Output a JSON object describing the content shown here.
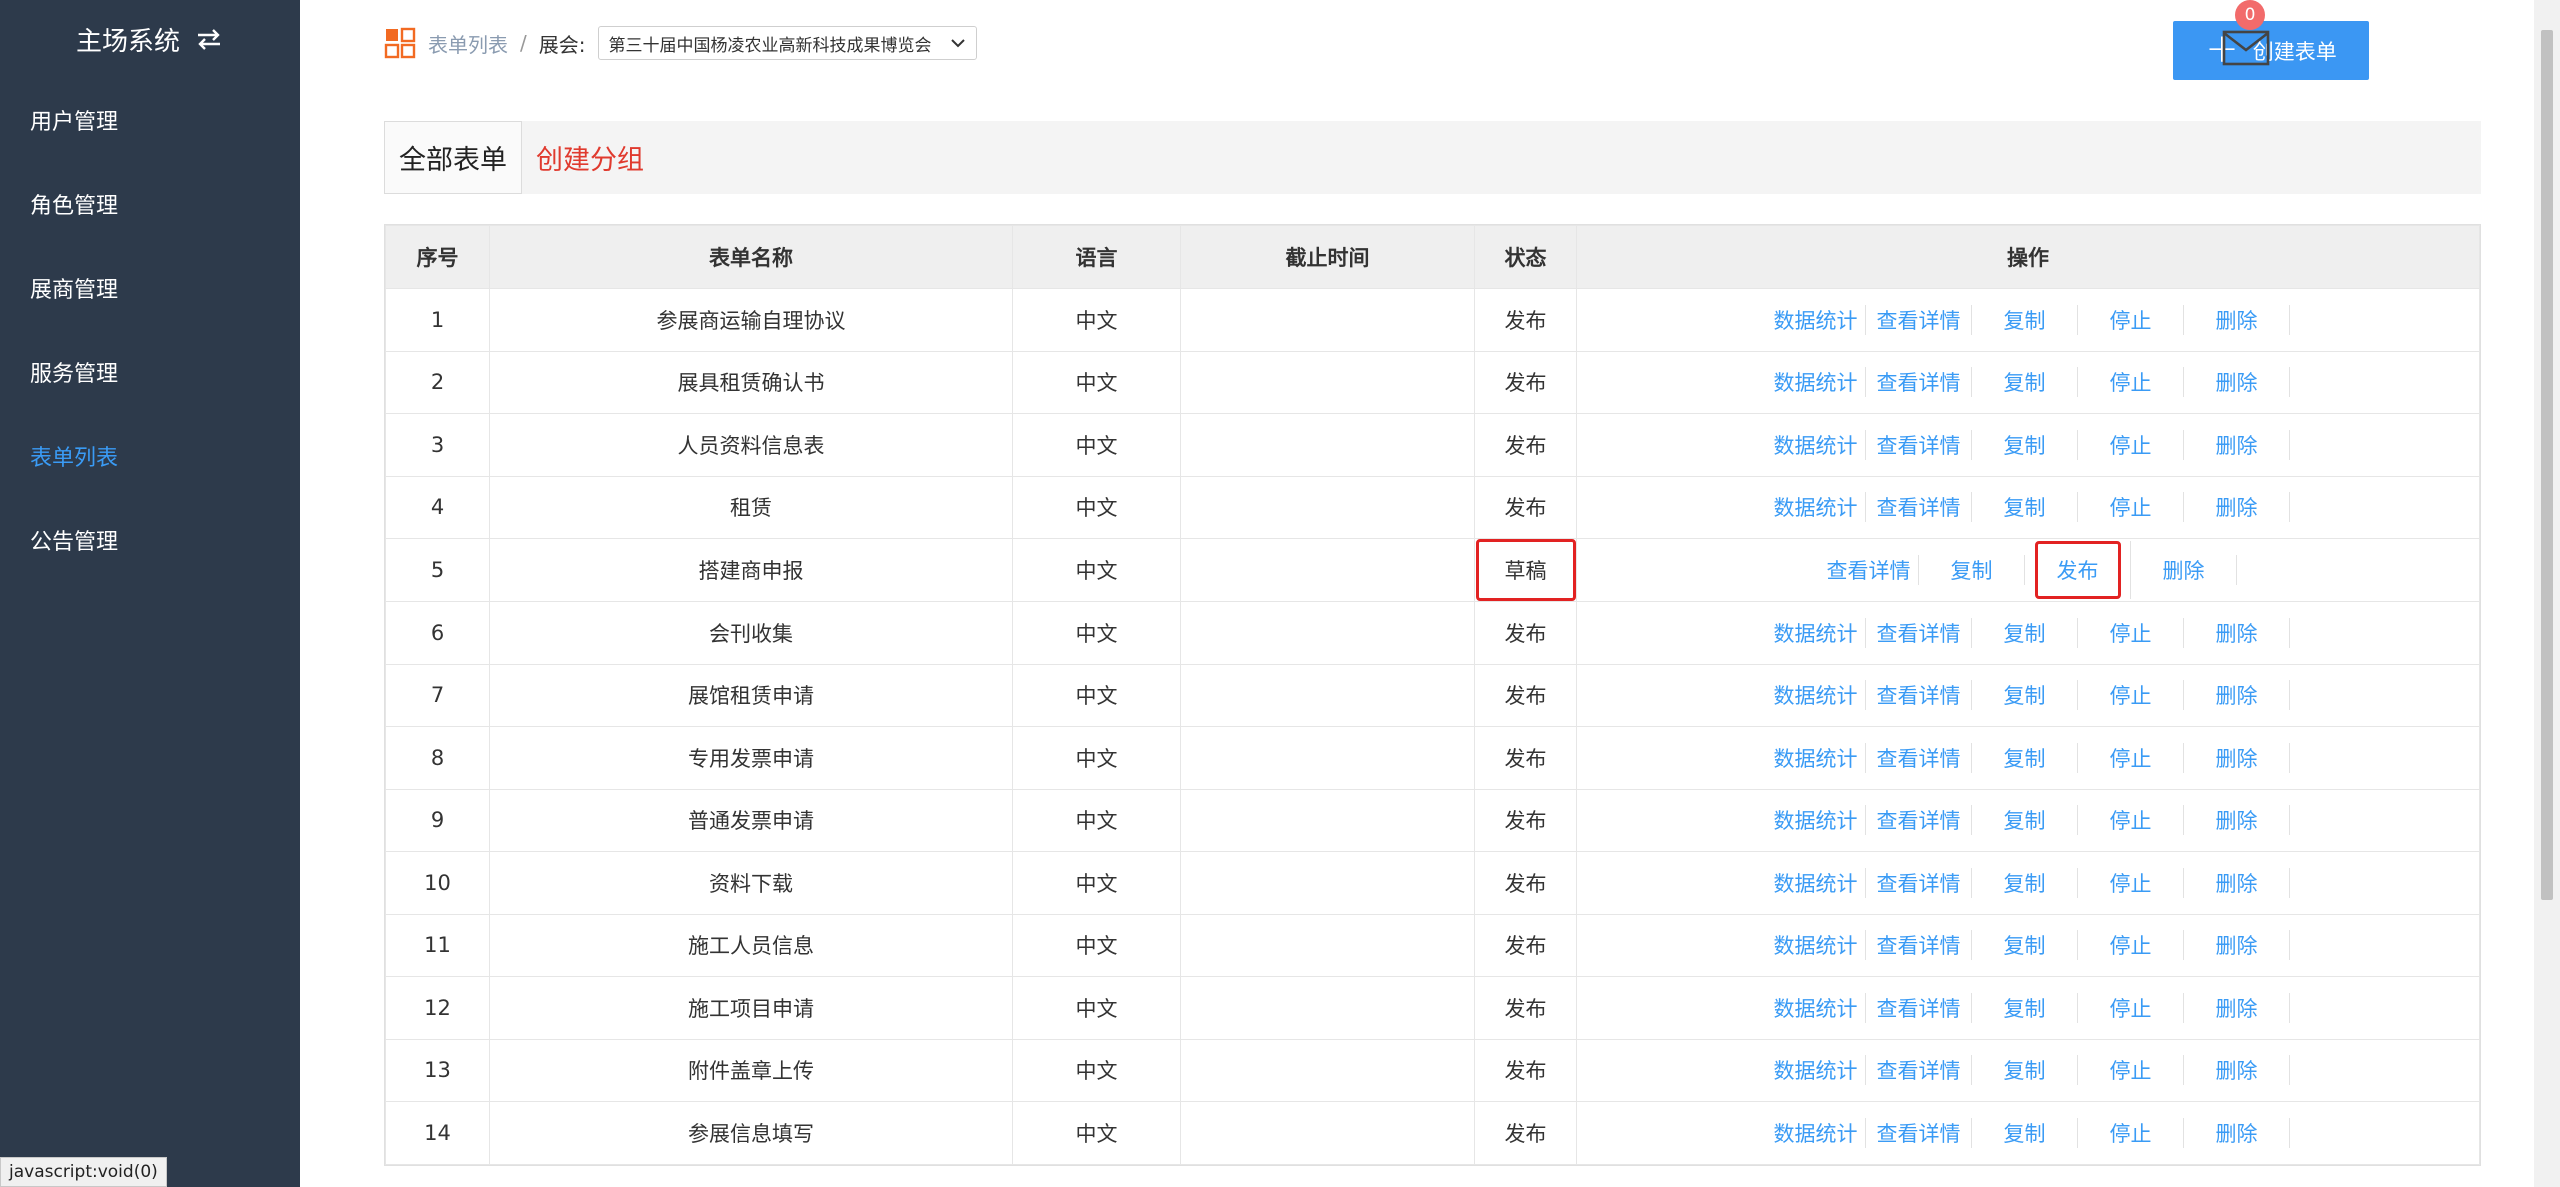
{
  "sidebar": {
    "brand": "主场系统",
    "items": [
      {
        "label": "用户管理"
      },
      {
        "label": "角色管理"
      },
      {
        "label": "展商管理"
      },
      {
        "label": "服务管理"
      },
      {
        "label": "表单列表"
      },
      {
        "label": "公告管理"
      }
    ],
    "active_index": 4
  },
  "header": {
    "breadcrumb_link": "表单列表",
    "breadcrumb_sep": "/",
    "expo_label": "展会:",
    "expo_selected": "第三十届中国杨凌农业高新科技成果博览会",
    "create_button": "创建表单",
    "mail_badge": "0"
  },
  "groups": {
    "all_tab": "全部表单",
    "create_group": "创建分组"
  },
  "table": {
    "columns": [
      "序号",
      "表单名称",
      "语言",
      "截止时间",
      "状态",
      "操作"
    ],
    "rows": [
      {
        "no": "1",
        "name": "参展商运输自理协议",
        "lang": "中文",
        "deadline": "",
        "status": "发布",
        "ops": [
          "数据统计",
          "查看详情",
          "复制",
          "停止",
          "删除"
        ]
      },
      {
        "no": "2",
        "name": "展具租赁确认书",
        "lang": "中文",
        "deadline": "",
        "status": "发布",
        "ops": [
          "数据统计",
          "查看详情",
          "复制",
          "停止",
          "删除"
        ]
      },
      {
        "no": "3",
        "name": "人员资料信息表",
        "lang": "中文",
        "deadline": "",
        "status": "发布",
        "ops": [
          "数据统计",
          "查看详情",
          "复制",
          "停止",
          "删除"
        ]
      },
      {
        "no": "4",
        "name": "租赁",
        "lang": "中文",
        "deadline": "",
        "status": "发布",
        "ops": [
          "数据统计",
          "查看详情",
          "复制",
          "停止",
          "删除"
        ]
      },
      {
        "no": "5",
        "name": "搭建商申报",
        "lang": "中文",
        "deadline": "",
        "status": "草稿",
        "ops": [
          "查看详情",
          "复制",
          "发布",
          "删除"
        ],
        "highlight": true
      },
      {
        "no": "6",
        "name": "会刊收集",
        "lang": "中文",
        "deadline": "",
        "status": "发布",
        "ops": [
          "数据统计",
          "查看详情",
          "复制",
          "停止",
          "删除"
        ]
      },
      {
        "no": "7",
        "name": "展馆租赁申请",
        "lang": "中文",
        "deadline": "",
        "status": "发布",
        "ops": [
          "数据统计",
          "查看详情",
          "复制",
          "停止",
          "删除"
        ]
      },
      {
        "no": "8",
        "name": "专用发票申请",
        "lang": "中文",
        "deadline": "",
        "status": "发布",
        "ops": [
          "数据统计",
          "查看详情",
          "复制",
          "停止",
          "删除"
        ]
      },
      {
        "no": "9",
        "name": "普通发票申请",
        "lang": "中文",
        "deadline": "",
        "status": "发布",
        "ops": [
          "数据统计",
          "查看详情",
          "复制",
          "停止",
          "删除"
        ]
      },
      {
        "no": "10",
        "name": "资料下载",
        "lang": "中文",
        "deadline": "",
        "status": "发布",
        "ops": [
          "数据统计",
          "查看详情",
          "复制",
          "停止",
          "删除"
        ]
      },
      {
        "no": "11",
        "name": "施工人员信息",
        "lang": "中文",
        "deadline": "",
        "status": "发布",
        "ops": [
          "数据统计",
          "查看详情",
          "复制",
          "停止",
          "删除"
        ]
      },
      {
        "no": "12",
        "name": "施工项目申请",
        "lang": "中文",
        "deadline": "",
        "status": "发布",
        "ops": [
          "数据统计",
          "查看详情",
          "复制",
          "停止",
          "删除"
        ]
      },
      {
        "no": "13",
        "name": "附件盖章上传",
        "lang": "中文",
        "deadline": "",
        "status": "发布",
        "ops": [
          "数据统计",
          "查看详情",
          "复制",
          "停止",
          "删除"
        ]
      },
      {
        "no": "14",
        "name": "参展信息填写",
        "lang": "中文",
        "deadline": "",
        "status": "发布",
        "ops": [
          "数据统计",
          "查看详情",
          "复制",
          "停止",
          "删除"
        ]
      }
    ]
  },
  "status_bar": "javascript:void(0)",
  "colors": {
    "sidebar_bg": "#2d3a4b",
    "accent": "#3a9bf5",
    "link": "#3a9bf5",
    "danger": "#e03a2e",
    "highlight": "#e22222"
  }
}
